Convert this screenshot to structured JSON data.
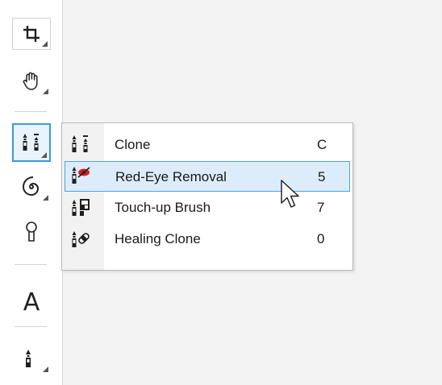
{
  "toolbar": {
    "tools": [
      {
        "name": "crop",
        "icon": "crop-icon",
        "has_flyout": true
      },
      {
        "name": "pan",
        "icon": "hand-icon",
        "has_flyout": true
      },
      {
        "name": "clone",
        "icon": "clone-brush-icon",
        "has_flyout": true
      },
      {
        "name": "liquify",
        "icon": "swirl-icon",
        "has_flyout": true
      },
      {
        "name": "brush",
        "icon": "brush-icon",
        "has_flyout": false
      },
      {
        "name": "text",
        "icon": "text-icon",
        "glyph": "A",
        "has_flyout": false
      },
      {
        "name": "paint",
        "icon": "paint-brush-icon",
        "has_flyout": true
      }
    ]
  },
  "flyout": {
    "items": [
      {
        "label": "Clone",
        "shortcut": "C",
        "icon": "clone-brush-icon",
        "highlighted": false
      },
      {
        "label": "Red-Eye Removal",
        "shortcut": "5",
        "icon": "red-eye-removal-icon",
        "highlighted": true
      },
      {
        "label": "Touch-up Brush",
        "shortcut": "7",
        "icon": "touch-up-brush-icon",
        "highlighted": false
      },
      {
        "label": "Healing Clone",
        "shortcut": "0",
        "icon": "healing-clone-icon",
        "highlighted": false
      }
    ]
  },
  "colors": {
    "active_border": "#3a9ad9",
    "highlight_bg": "#dcecfa",
    "highlight_border": "#4ea2e0",
    "red_eye": "#d42020"
  }
}
